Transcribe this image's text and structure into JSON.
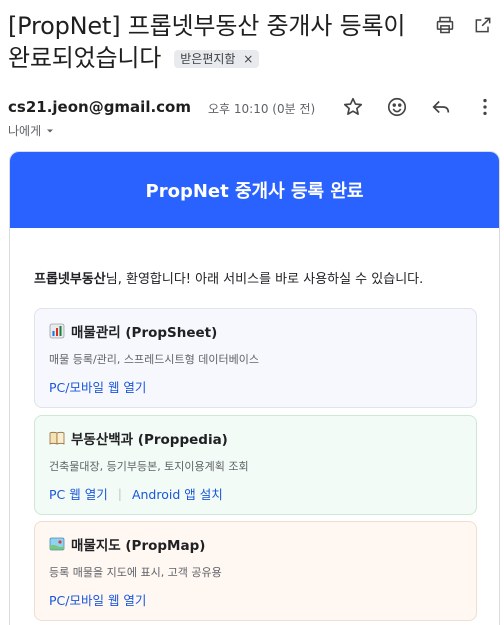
{
  "email": {
    "subject": "[PropNet] 프롭넷부동산 중개사 등록이 완료되었습니다",
    "label_chip": "받은편지함",
    "label_chip_close": "×",
    "sender": "cs21.jeon@gmail.com",
    "recipient": "나에게",
    "time": "오후 10:10 (0분 전)"
  },
  "body": {
    "banner_title": "PropNet 중개사 등록 완료",
    "welcome_name": "프롭넷부동산",
    "welcome_rest": "님, 환영합니다! 아래 서비스를 바로 사용하실 수 있습니다.",
    "services": [
      {
        "title": "매물관리 (PropSheet)",
        "icon": "bar-chart-icon",
        "desc": "매물 등록/관리, 스프레드시트형 데이터베이스",
        "links": [
          "PC/모바일 웹 열기"
        ]
      },
      {
        "title": "부동산백과 (Proppedia)",
        "icon": "book-icon",
        "desc": "건축물대장, 등기부등본, 토지이용계획 조회",
        "links": [
          "PC 웹 열기",
          "Android 앱 설치"
        ],
        "separator": "|"
      },
      {
        "title": "매물지도 (PropMap)",
        "icon": "map-icon",
        "desc": "등록 매물을 지도에 표시, 고객 공유용",
        "links": [
          "PC/모바일 웹 열기"
        ]
      }
    ]
  },
  "colors": {
    "banner": "#2962ff",
    "link": "#1a56db"
  }
}
